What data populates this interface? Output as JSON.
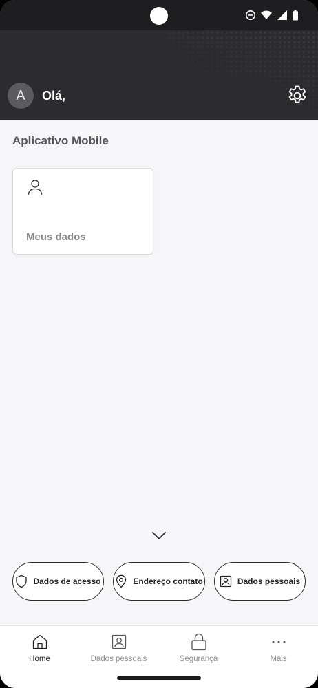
{
  "header": {
    "avatar_initial": "A",
    "greeting": "Olá,"
  },
  "main": {
    "section_title": "Aplicativo Mobile",
    "cards": [
      {
        "label": "Meus dados",
        "icon": "person-icon"
      }
    ],
    "quick_actions": [
      {
        "label": "Dados de acesso",
        "icon": "shield-icon"
      },
      {
        "label": "Endereço contato",
        "icon": "location-pin-icon"
      },
      {
        "label": "Dados pessoais",
        "icon": "id-badge-icon"
      }
    ]
  },
  "bottom_nav": {
    "items": [
      {
        "label": "Home",
        "icon": "home-icon",
        "active": true
      },
      {
        "label": "Dados pessoais",
        "icon": "id-badge-icon",
        "active": false
      },
      {
        "label": "Segurança",
        "icon": "lock-icon",
        "active": false
      },
      {
        "label": "Mais",
        "icon": "more-dots-icon",
        "active": false
      }
    ]
  },
  "colors": {
    "header_bg": "#2c2c2e",
    "page_bg": "#f6f5f7",
    "text_dark": "#222226",
    "text_muted": "#8e8d92"
  }
}
